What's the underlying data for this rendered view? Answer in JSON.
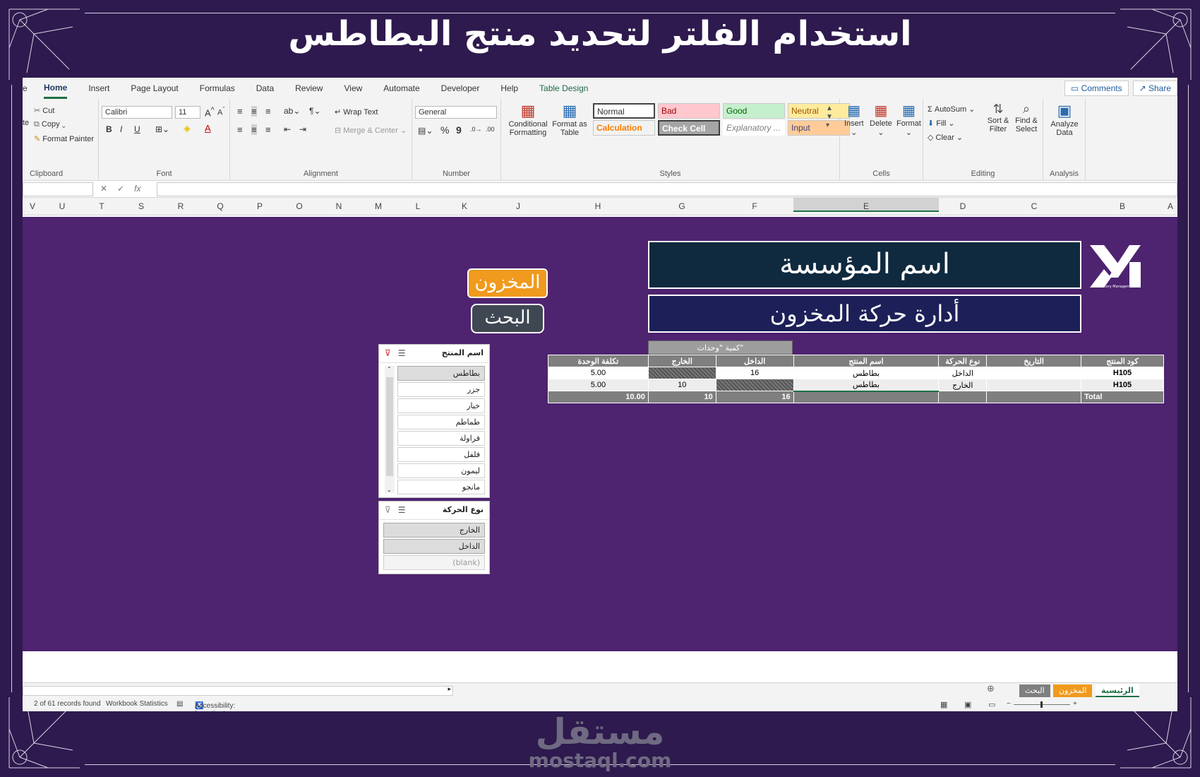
{
  "banner": {
    "title": "استخدام الفلتر  لتحديد منتج البطاطس"
  },
  "menu": {
    "tabs": [
      "e",
      "Home",
      "Insert",
      "Page Layout",
      "Formulas",
      "Data",
      "Review",
      "View",
      "Automate",
      "Developer",
      "Help",
      "Table Design"
    ],
    "comments": "Comments",
    "share": "Share"
  },
  "ribbon": {
    "clipboard": {
      "paste": "te",
      "cut": "Cut",
      "copy": "Copy",
      "format_painter": "Format Painter",
      "label": "Clipboard"
    },
    "font": {
      "name": "Calibri",
      "size": "11",
      "bold": "B",
      "italic": "I",
      "underline": "U",
      "label": "Font"
    },
    "alignment": {
      "wrap": "Wrap Text",
      "merge": "Merge & Center",
      "label": "Alignment"
    },
    "number": {
      "format": "General",
      "percent": "%",
      "comma": "9",
      "label": "Number"
    },
    "styles": {
      "conditional": "Conditional Formatting",
      "format_table": "Format as Table",
      "normal": "Normal",
      "bad": "Bad",
      "good": "Good",
      "neutral": "Neutral",
      "calculation": "Calculation",
      "check_cell": "Check Cell",
      "explanatory": "Explanatory ...",
      "input": "Input",
      "label": "Styles"
    },
    "cells": {
      "insert": "Insert",
      "delete": "Delete",
      "format": "Format",
      "label": "Cells"
    },
    "editing": {
      "autosum": "AutoSum",
      "fill": "Fill",
      "clear": "Clear",
      "sort": "Sort & Filter",
      "find": "Find & Select",
      "label": "Editing"
    },
    "analysis": {
      "analyze": "Analyze Data",
      "label": "Analysis"
    }
  },
  "formula": {
    "fx": "fx",
    "cancel": "✕",
    "enter": "✓"
  },
  "columns": [
    "V",
    "U",
    "T",
    "S",
    "R",
    "Q",
    "P",
    "O",
    "N",
    "M",
    "L",
    "K",
    "J",
    "H",
    "G",
    "F",
    "E",
    "D",
    "C",
    "B",
    "A"
  ],
  "sheet": {
    "org_name": "اسم المؤسسة",
    "subtitle": "أدارة حركة المخزون",
    "logo_caption": "Inventory Management",
    "btn_inventory": "المخزون",
    "btn_search": "البحث"
  },
  "table": {
    "qty_header": "كمية \"وحدات\"",
    "headers": [
      "تكلفة الوحدة",
      "الخارج",
      "الداخل",
      "اسم المنتج",
      "نوع الحركة",
      "التاريخ",
      "كود المنتج"
    ],
    "rows": [
      {
        "cost": "5.00",
        "out": "",
        "in": "16",
        "product": "بطاطس",
        "type": "الداخل",
        "date": "",
        "code": "H105"
      },
      {
        "cost": "5.00",
        "out": "10",
        "in": "",
        "product": "بطاطس",
        "type": "الخارج",
        "date": "",
        "code": "H105"
      }
    ],
    "total": {
      "cost": "10.00",
      "out": "10",
      "in": "16",
      "label": "Total"
    }
  },
  "slicer_product": {
    "title": "اسم المنتج",
    "items": [
      "بطاطس",
      "جزر",
      "خيار",
      "طماطم",
      "فراولة",
      "فلفل",
      "ليمون",
      "مانجو"
    ]
  },
  "slicer_type": {
    "title": "نوع الحركة",
    "items": [
      "الخارج",
      "الداخل",
      "(blank)"
    ]
  },
  "sheet_tabs": [
    "البحث",
    "المخزون",
    "الرئيسية"
  ],
  "status": {
    "records": "2 of 61 records found",
    "workbook": "Workbook Statistics",
    "accessibility": "Accessibility: Investigate"
  },
  "watermark": {
    "ar": "مستقل",
    "en": "mostaql.com"
  },
  "colors": {
    "sheet_bg": "#4e2370",
    "page_bg": "#2e1a4e",
    "orange": "#f09a1e",
    "org_bg": "#0f2a3f",
    "subtitle_bg": "#1d2058"
  }
}
